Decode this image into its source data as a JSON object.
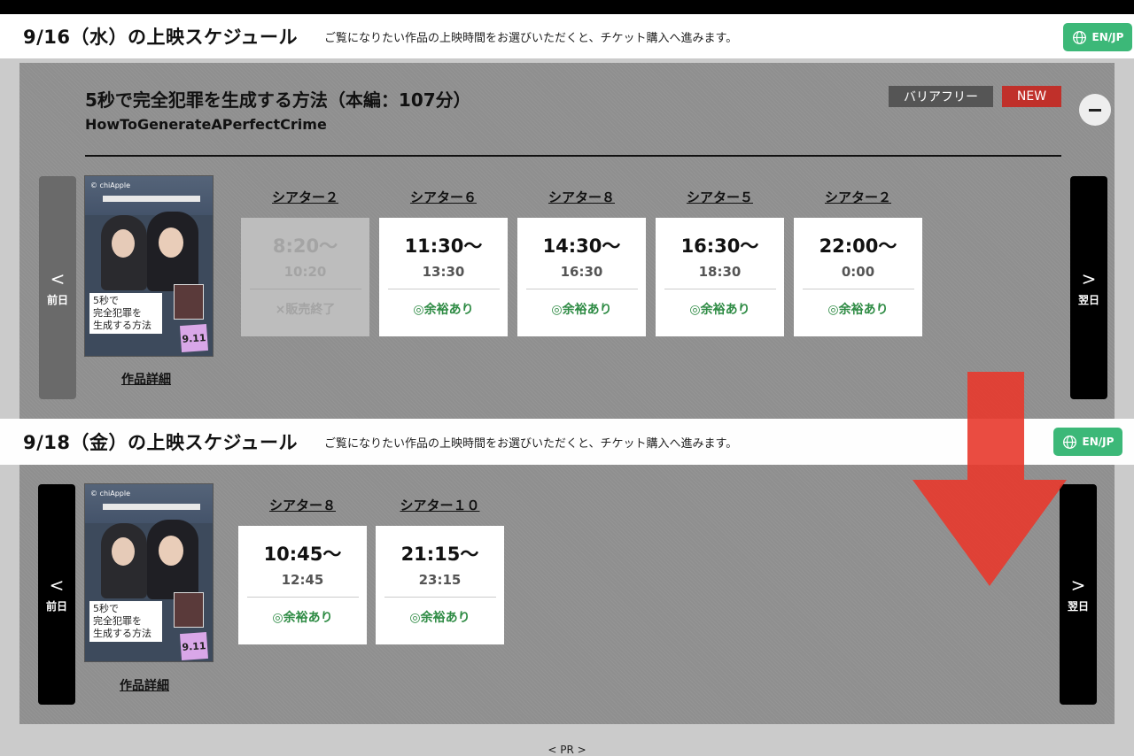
{
  "schedules": [
    {
      "title": "9/16（水）の上映スケジュール",
      "description": "ご覧になりたい作品の上映時間をお選びいただくと、チケット購入へ進みます。",
      "lang_button": "EN/JP",
      "movie": {
        "title": "5秒で完全犯罪を生成する方法（本編：107分）",
        "subtitle": "HowToGenerateAPerfectCrime",
        "badge_barrier_free": "バリアフリー",
        "badge_new": "NEW"
      },
      "prev_label": "前日",
      "next_label": "翌日",
      "prev_chevron": "<",
      "next_chevron": ">",
      "detail_link": "作品詳細",
      "showtimes": [
        {
          "theater": "シアター２",
          "start": "8:20〜",
          "end": "10:20",
          "status": "×販売終了",
          "state": "ended"
        },
        {
          "theater": "シアター６",
          "start": "11:30〜",
          "end": "13:30",
          "status": "◎余裕あり",
          "state": "available"
        },
        {
          "theater": "シアター８",
          "start": "14:30〜",
          "end": "16:30",
          "status": "◎余裕あり",
          "state": "available"
        },
        {
          "theater": "シアター５",
          "start": "16:30〜",
          "end": "18:30",
          "status": "◎余裕あり",
          "state": "available"
        },
        {
          "theater": "シアター２",
          "start": "22:00〜",
          "end": "0:00",
          "status": "◎余裕あり",
          "state": "available"
        }
      ]
    },
    {
      "title": "9/18（金）の上映スケジュール",
      "description": "ご覧になりたい作品の上映時間をお選びいただくと、チケット購入へ進みます。",
      "lang_button": "EN/JP",
      "prev_label": "前日",
      "next_label": "翌日",
      "prev_chevron": "<",
      "next_chevron": ">",
      "detail_link": "作品詳細",
      "showtimes": [
        {
          "theater": "シアター８",
          "start": "10:45〜",
          "end": "12:45",
          "status": "◎余裕あり",
          "state": "available"
        },
        {
          "theater": "シアター１０",
          "start": "21:15〜",
          "end": "23:15",
          "status": "◎余裕あり",
          "state": "available"
        }
      ]
    }
  ],
  "poster": {
    "logo": "© chiApple",
    "caption": "5秒で\n完全犯罪を\n生成する方法",
    "note": "9.11"
  },
  "footer_pr": "< PR >",
  "colors": {
    "lang_button": "#3cb878",
    "badge_new": "#c0302a",
    "badge_barrier_free": "#555555",
    "status_available": "#2e8b44",
    "overlay_arrow": "#e8392c"
  }
}
